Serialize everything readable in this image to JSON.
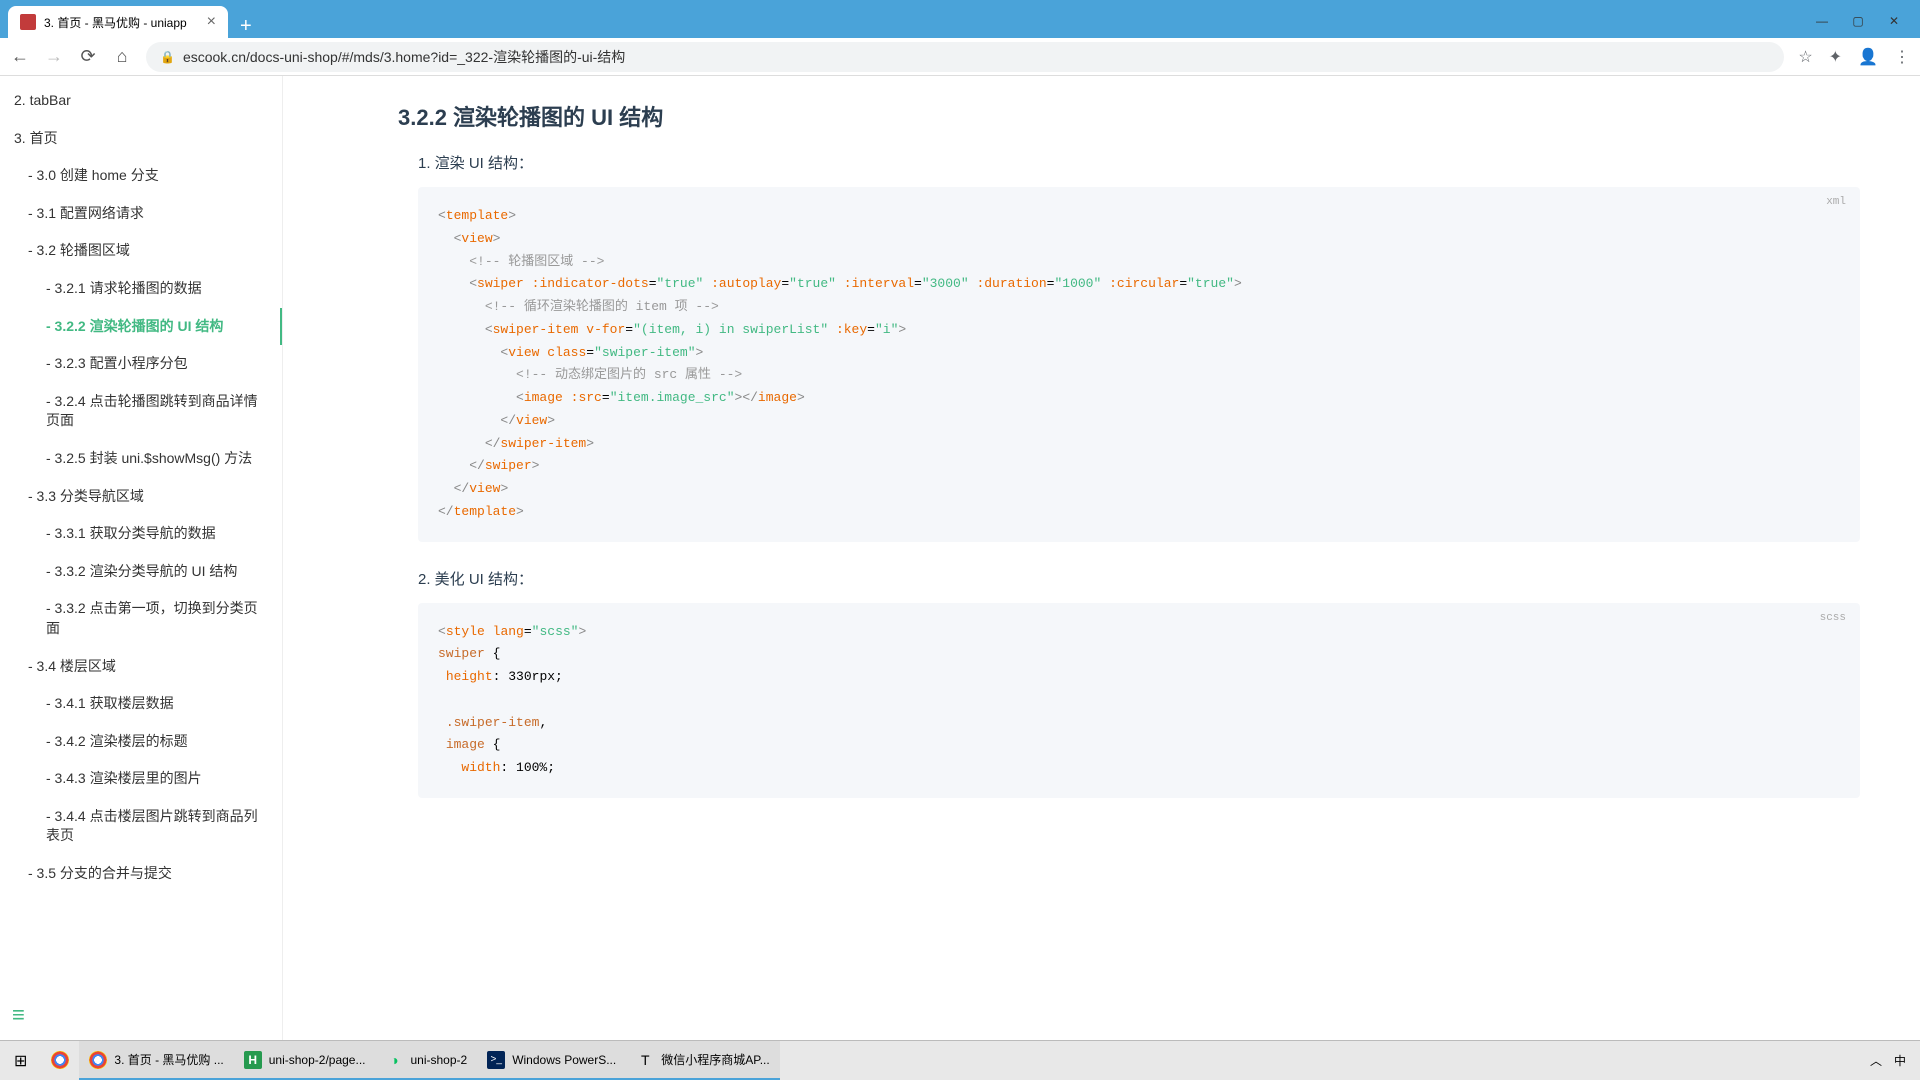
{
  "browser": {
    "tab_title": "3. 首页 - 黑马优购 - uniapp",
    "url": "escook.cn/docs-uni-shop/#/mds/3.home?id=_322-渲染轮播图的-ui-结构"
  },
  "sidebar": {
    "items": [
      {
        "label": "2. tabBar",
        "level": 0
      },
      {
        "label": "3. 首页",
        "level": 0
      },
      {
        "label": "- 3.0 创建 home 分支",
        "level": 1
      },
      {
        "label": "- 3.1 配置网络请求",
        "level": 1
      },
      {
        "label": "- 3.2 轮播图区域",
        "level": 1
      },
      {
        "label": "- 3.2.1 请求轮播图的数据",
        "level": 2
      },
      {
        "label": "- 3.2.2 渲染轮播图的 UI 结构",
        "level": 2,
        "active": true
      },
      {
        "label": "- 3.2.3 配置小程序分包",
        "level": 2
      },
      {
        "label": "- 3.2.4 点击轮播图跳转到商品详情页面",
        "level": 2
      },
      {
        "label": "- 3.2.5 封装 uni.$showMsg() 方法",
        "level": 2
      },
      {
        "label": "- 3.3 分类导航区域",
        "level": 1
      },
      {
        "label": "- 3.3.1 获取分类导航的数据",
        "level": 2
      },
      {
        "label": "- 3.3.2 渲染分类导航的 UI 结构",
        "level": 2
      },
      {
        "label": "- 3.3.2 点击第一项，切换到分类页面",
        "level": 2
      },
      {
        "label": "- 3.4 楼层区域",
        "level": 1
      },
      {
        "label": "- 3.4.1 获取楼层数据",
        "level": 2
      },
      {
        "label": "- 3.4.2 渲染楼层的标题",
        "level": 2
      },
      {
        "label": "- 3.4.3 渲染楼层里的图片",
        "level": 2
      },
      {
        "label": "- 3.4.4 点击楼层图片跳转到商品列表页",
        "level": 2
      },
      {
        "label": "- 3.5 分支的合并与提交",
        "level": 1
      }
    ]
  },
  "main": {
    "title": "3.2.2 渲染轮播图的 UI 结构",
    "step1": "1. 渲染 UI 结构：",
    "step2": "2. 美化 UI 结构：",
    "lang1": "xml",
    "lang2": "scss"
  },
  "code1": {
    "c1": "<!-- 轮播图区域 -->",
    "c2": "<!-- 循环渲染轮播图的 item 项 -->",
    "c3": "<!-- 动态绑定图片的 src 属性 -->",
    "a_indicator": ":indicator-dots",
    "a_autoplay": ":autoplay",
    "a_interval": ":interval",
    "a_duration": ":duration",
    "a_circular": ":circular",
    "v_true": "\"true\"",
    "v_3000": "\"3000\"",
    "v_1000": "\"1000\"",
    "vfor": "v-for",
    "vfor_val": "\"(item, i) in swiperList\"",
    "key": ":key",
    "key_val": "\"i\"",
    "class": "class",
    "class_val": "\"swiper-item\"",
    "src": ":src",
    "src_val": "\"item.image_src\""
  },
  "code2": {
    "lang_attr": "lang",
    "lang_val": "\"scss\"",
    "sel_swiper": "swiper",
    "sel_item": ".swiper-item",
    "sel_image": "image",
    "prop_height": "height",
    "val_height": "330rpx",
    "prop_width": "width",
    "val_width": "100%"
  },
  "taskbar": {
    "items": [
      {
        "label": "3. 首页 - 黑马优购 ...",
        "icon": "chrome"
      },
      {
        "label": "uni-shop-2/page...",
        "icon": "hbuilder"
      },
      {
        "label": "uni-shop-2",
        "icon": "wechat"
      },
      {
        "label": "Windows PowerS...",
        "icon": "powershell"
      },
      {
        "label": "微信小程序商城AP...",
        "icon": "text"
      }
    ]
  }
}
